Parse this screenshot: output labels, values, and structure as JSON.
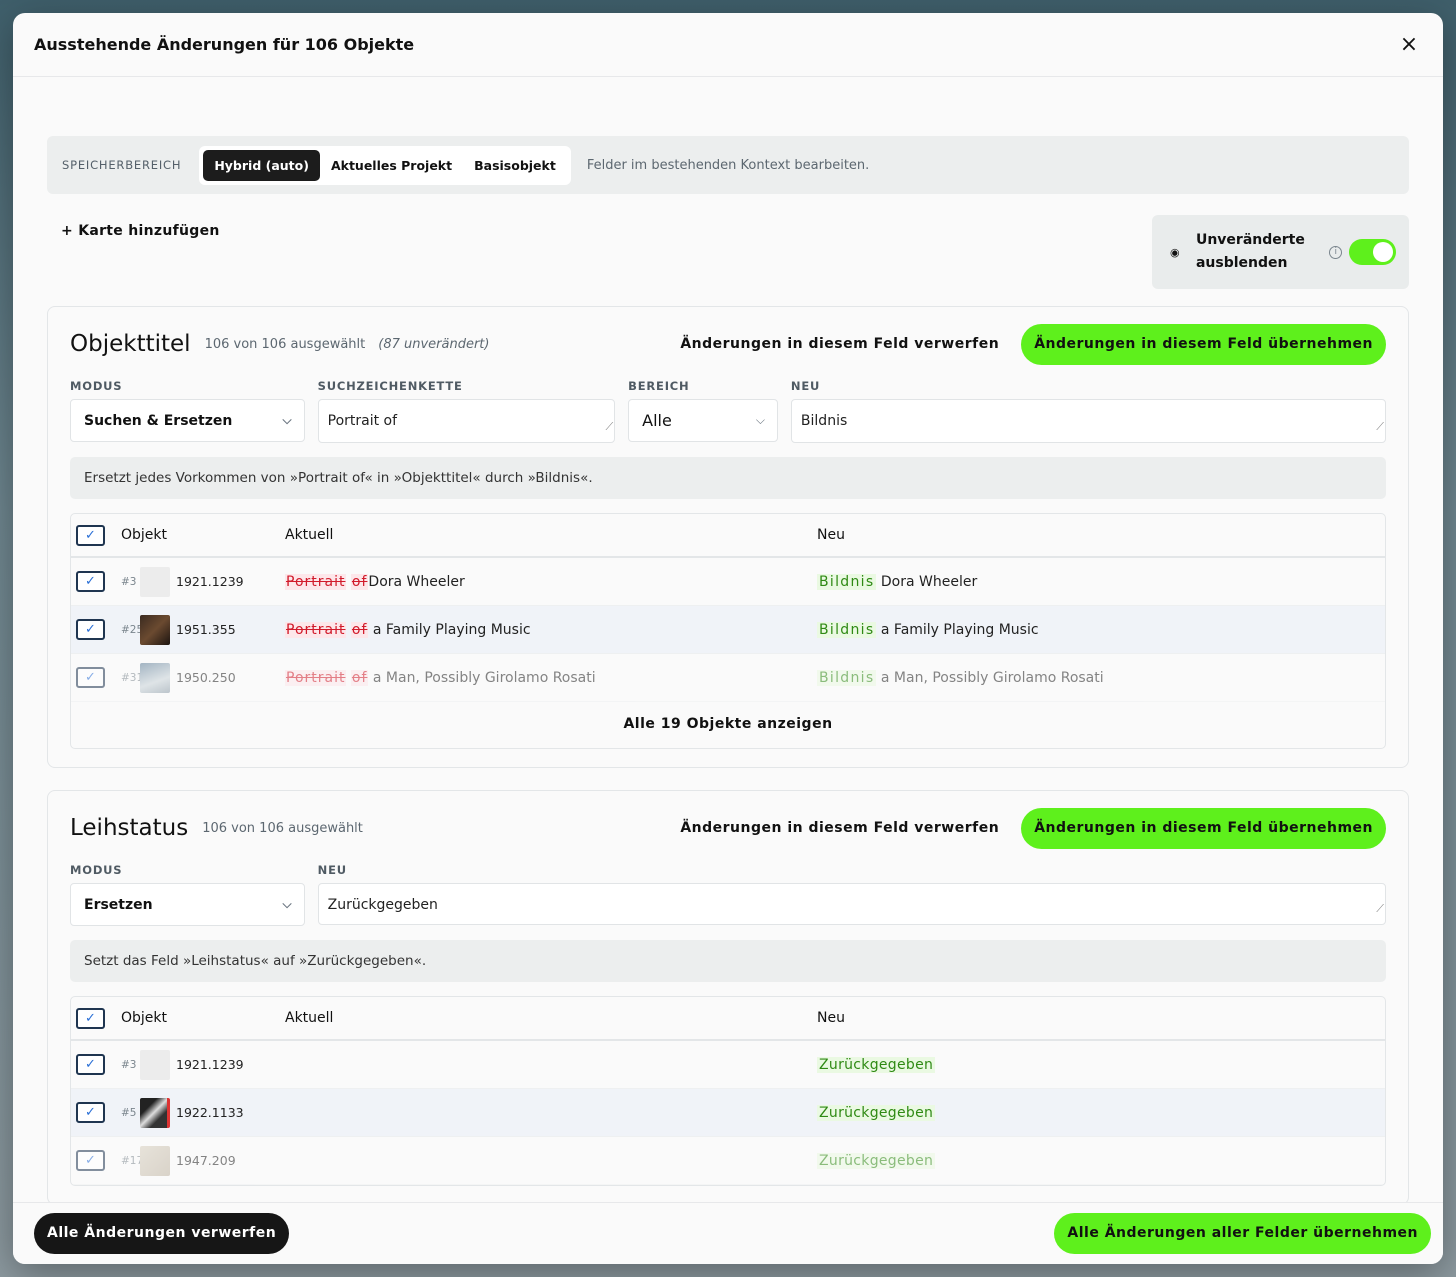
{
  "modal": {
    "title": "Ausstehende Änderungen für 106 Objekte",
    "close_icon": "×"
  },
  "scope": {
    "label": "SPEICHERBEREICH",
    "options": [
      "Hybrid (auto)",
      "Aktuelles Projekt",
      "Basisobjekt"
    ],
    "selected": "Hybrid (auto)",
    "hint": "Felder im bestehenden Kontext bearbeiten."
  },
  "tools": {
    "add_card": "+ Karte hinzufügen",
    "hide_unchanged_label": "Unveränderte ausblenden",
    "hide_unchanged_on": true
  },
  "cards": [
    {
      "title": "Objekttitel",
      "selected_text": "106 von 106 ausgewählt",
      "unchanged_text": "(87 unverändert)",
      "discard_label": "Änderungen in diesem Feld verwerfen",
      "apply_label": "Änderungen in diesem Feld übernehmen",
      "fields": {
        "mode_label": "MODUS",
        "mode_value": "Suchen & Ersetzen",
        "search_label": "SUCHZEICHENKETTE",
        "search_value": "Portrait of",
        "scope_label": "BEREICH",
        "scope_value": "Alle",
        "new_label": "NEU",
        "new_value": "Bildnis"
      },
      "note": "Ersetzt jedes Vorkommen von »Portrait of« in »Objekttitel« durch »Bildnis«.",
      "table": {
        "headers": [
          "Objekt",
          "Aktuell",
          "Neu"
        ],
        "rows": [
          {
            "index": "#3",
            "inv": "1921.1239",
            "del1": "Portrait",
            "del2": "of",
            "rest": "Dora Wheeler",
            "ins": "Bildnis",
            "new_rest": "Dora Wheeler"
          },
          {
            "index": "#25",
            "inv": "1951.355",
            "del1": "Portrait",
            "del2": "of",
            "rest": "a Family Playing Music",
            "ins": "Bildnis",
            "new_rest": "a Family Playing Music"
          },
          {
            "index": "#31",
            "inv": "1950.250",
            "del1": "Portrait",
            "del2": "of",
            "rest": "a Man, Possibly Girolamo Rosati",
            "ins": "Bildnis",
            "new_rest": "a Man, Possibly Girolamo Rosati"
          }
        ],
        "show_all": "Alle 19 Objekte anzeigen"
      }
    },
    {
      "title": "Leihstatus",
      "selected_text": "106 von 106 ausgewählt",
      "discard_label": "Änderungen in diesem Feld verwerfen",
      "apply_label": "Änderungen in diesem Feld übernehmen",
      "fields": {
        "mode_label": "MODUS",
        "mode_value": "Ersetzen",
        "new_label": "NEU",
        "new_value": "Zurückgegeben"
      },
      "note": "Setzt das Feld »Leihstatus« auf »Zurückgegeben«.",
      "table": {
        "headers": [
          "Objekt",
          "Aktuell",
          "Neu"
        ],
        "rows": [
          {
            "index": "#3",
            "inv": "1921.1239",
            "ins": "Zurückgegeben"
          },
          {
            "index": "#5",
            "inv": "1922.1133",
            "ins": "Zurückgegeben"
          },
          {
            "index": "#17",
            "inv": "1947.209",
            "ins": "Zurückgegeben"
          }
        ]
      }
    }
  ],
  "footer": {
    "discard_all": "Alle Änderungen verwerfen",
    "apply_all": "Alle Änderungen aller Felder übernehmen"
  },
  "colors": {
    "accent_green": "#5ef01c",
    "dark": "#161616",
    "deletion_red": "#d11b2b",
    "insertion_green": "#2f8a14"
  }
}
